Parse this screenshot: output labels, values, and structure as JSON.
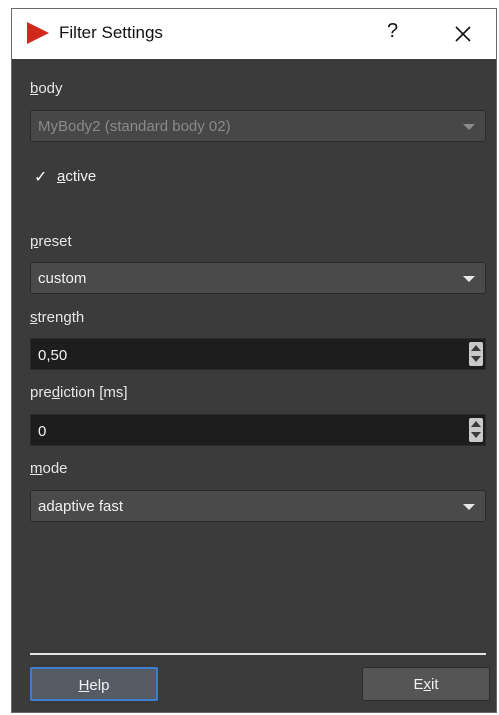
{
  "window": {
    "title": "Filter Settings",
    "help_glyph": "?",
    "close_icon": "close-icon",
    "app_icon": "play-triangle-icon",
    "accent_color": "#d0281b"
  },
  "body": {
    "label_first": "b",
    "label_rest": "ody",
    "value": "MyBody2 (standard body 02)",
    "disabled": true
  },
  "active": {
    "checked": true,
    "check_glyph": "✓",
    "label_first": "a",
    "label_rest": "ctive"
  },
  "preset": {
    "label_first": "p",
    "label_rest": "reset",
    "value": "custom"
  },
  "strength": {
    "label_first": "s",
    "label_rest": "trength",
    "value": "0,50"
  },
  "prediction": {
    "label_pre": "pre",
    "label_u": "d",
    "label_post": "iction [ms]",
    "value": "0"
  },
  "mode": {
    "label_first": "m",
    "label_rest": "ode",
    "value": "adaptive fast"
  },
  "buttons": {
    "help": {
      "label_first": "H",
      "label_rest": "elp"
    },
    "exit": {
      "label_pre": "E",
      "label_u": "x",
      "label_post": "it"
    }
  }
}
